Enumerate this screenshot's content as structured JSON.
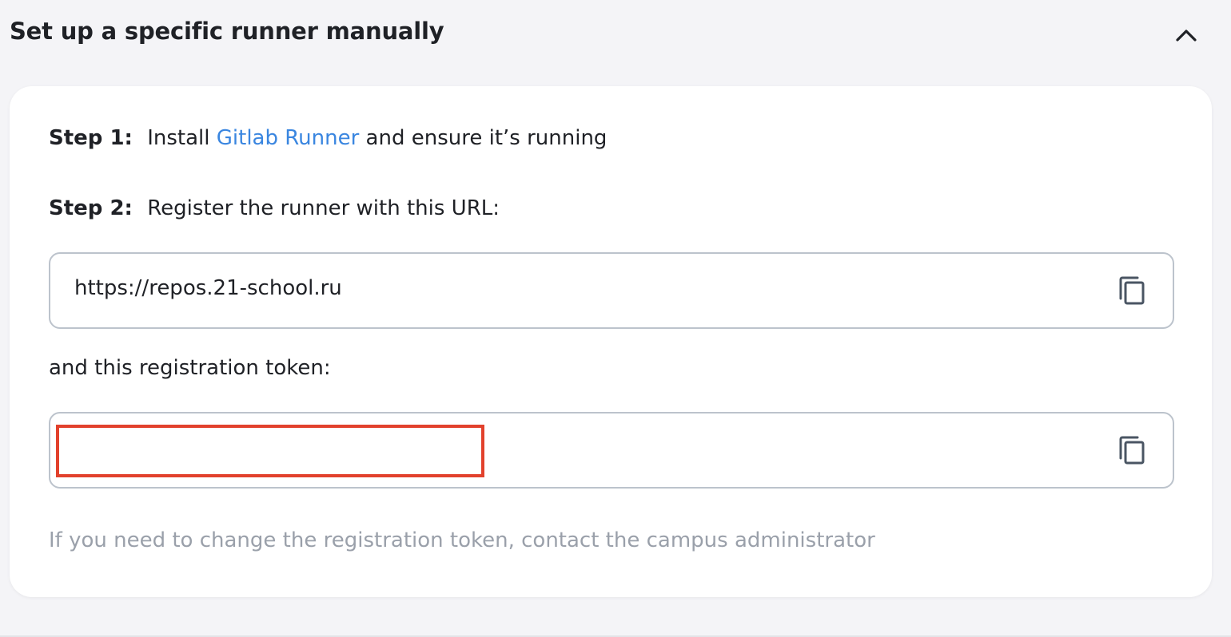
{
  "section": {
    "title": "Set up a specific runner manually",
    "toggle_icon": "chevron-up-icon"
  },
  "step1": {
    "label": "Step 1:",
    "text_before": "Install",
    "link_text": "Gitlab Runner",
    "text_after": "and ensure it’s running"
  },
  "step2": {
    "label": "Step 2:",
    "text": "Register the runner with this URL:"
  },
  "url_field": {
    "value": "https://repos.21-school.ru",
    "copy_icon": "copy-icon"
  },
  "token": {
    "label": "and this registration token:",
    "value": "",
    "copy_icon": "copy-icon"
  },
  "hint": {
    "text": "If you need to change the registration token, contact the campus administrator"
  },
  "colors": {
    "link": "#3a86e0",
    "redaction_border": "#e2412c",
    "hint_text": "#9aa0aa",
    "field_border": "#bcc3cc",
    "page_background": "#f4f4f7"
  }
}
